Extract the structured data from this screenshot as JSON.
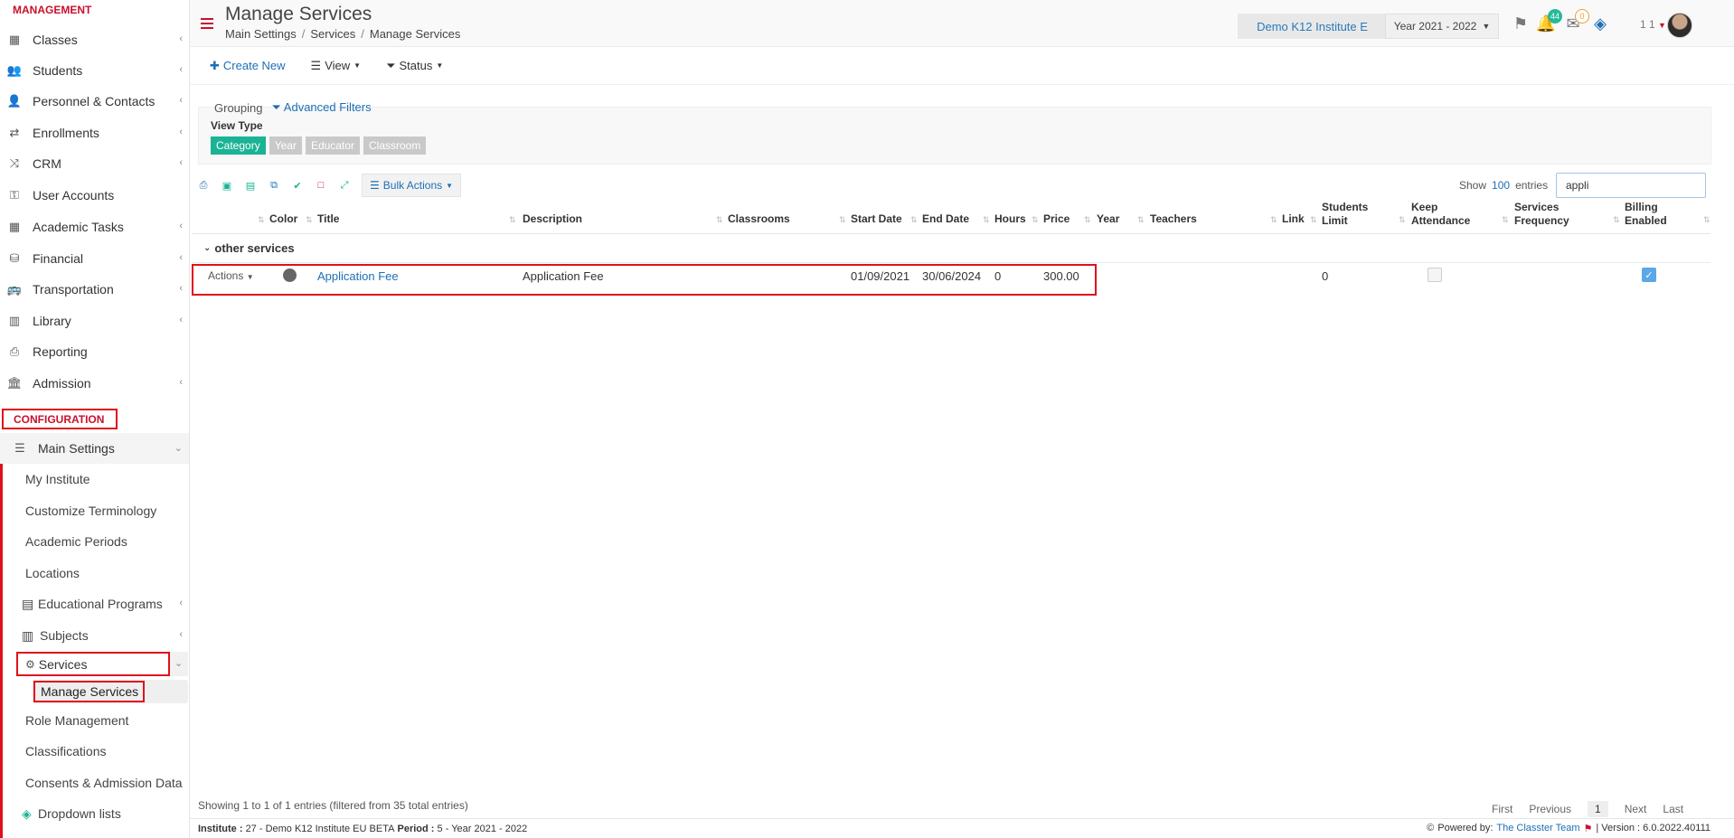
{
  "sidebar": {
    "management_title": "MANAGEMENT",
    "config_title": "CONFIGURATION",
    "items": [
      {
        "label": "Classes",
        "icon": "classes-icon"
      },
      {
        "label": "Students",
        "icon": "students-icon"
      },
      {
        "label": "Personnel & Contacts",
        "icon": "personnel-icon"
      },
      {
        "label": "Enrollments",
        "icon": "enrollments-icon"
      },
      {
        "label": "CRM",
        "icon": "crm-icon"
      },
      {
        "label": "User Accounts",
        "icon": "key-icon"
      },
      {
        "label": "Academic Tasks",
        "icon": "tasks-icon"
      },
      {
        "label": "Financial",
        "icon": "coins-icon"
      },
      {
        "label": "Transportation",
        "icon": "bus-icon"
      },
      {
        "label": "Library",
        "icon": "books-icon"
      },
      {
        "label": "Reporting",
        "icon": "print-icon"
      },
      {
        "label": "Admission",
        "icon": "bank-icon"
      }
    ],
    "config": {
      "main_settings": "Main Settings",
      "subitems": [
        "My Institute",
        "Customize Terminology",
        "Academic Periods",
        "Locations",
        "Educational Programs",
        "Subjects",
        "Services",
        "Manage Services",
        "Role Management",
        "Classifications",
        "Consents & Admission Data",
        "Dropdown lists"
      ]
    }
  },
  "header": {
    "title": "Manage Services",
    "breadcrumb": [
      "Main Settings",
      "Services",
      "Manage Services"
    ],
    "institute": "Demo K12 Institute E",
    "year": "Year 2021 - 2022",
    "notif_count": "44",
    "mail_count": "0",
    "user_num": "1 1"
  },
  "toolbar": {
    "create": "Create New",
    "view": "View",
    "status": "Status"
  },
  "filters": {
    "grouping": "Grouping",
    "advanced": "Advanced Filters",
    "view_type": "View Type",
    "tags": [
      "Category",
      "Year",
      "Educator",
      "Classroom"
    ]
  },
  "table_controls": {
    "bulk": "Bulk Actions",
    "show": "Show",
    "entries_count": "100",
    "entries": "entries",
    "search_value": "appli"
  },
  "table": {
    "columns": [
      "Color",
      "Title",
      "Description",
      "Classrooms",
      "Start Date",
      "End Date",
      "Hours",
      "Price",
      "Year",
      "Teachers",
      "Link",
      "Students Limit",
      "Keep Attendance",
      "Services Frequency",
      "Billing Enabled"
    ],
    "group": "other services",
    "row": {
      "actions": "Actions",
      "title": "Application Fee",
      "description": "Application Fee",
      "start": "01/09/2021",
      "end": "30/06/2024",
      "hours": "0",
      "price": "300.00",
      "students_limit": "0"
    }
  },
  "footer": {
    "showing": "Showing 1 to 1 of 1 entries (filtered from 35 total entries)",
    "pager": [
      "First",
      "Previous",
      "1",
      "Next",
      "Last"
    ],
    "institute_label": "Institute :",
    "institute_val": "27 - Demo K12 Institute EU BETA",
    "period_label": "Period :",
    "period_val": "5 - Year 2021 - 2022",
    "powered": "Powered by:",
    "team": "The Classter Team",
    "version": "| Version : 6.0.2022.40111"
  }
}
